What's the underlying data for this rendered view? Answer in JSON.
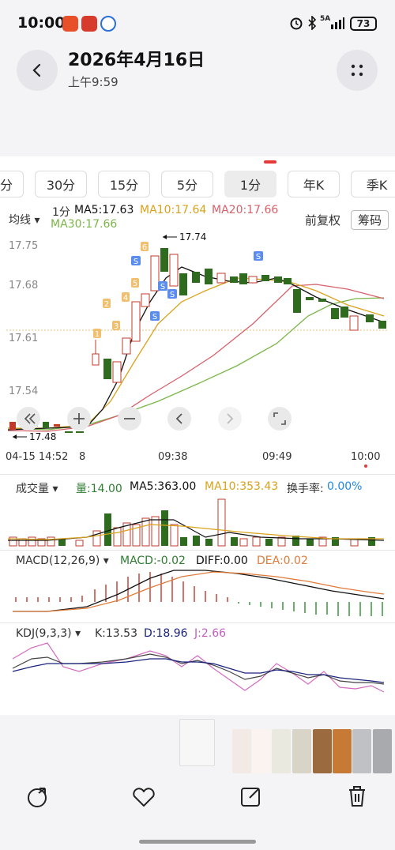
{
  "status": {
    "time": "10:00",
    "net": "5A",
    "battery": "73"
  },
  "header": {
    "title": "2026年4月16日",
    "subtitle": "上午9:59"
  },
  "chart": {
    "tabs": [
      "分",
      "30分",
      "15分",
      "5分",
      "1分",
      "年K",
      "季K"
    ],
    "active_tab": "1分",
    "avg_label": "均线",
    "period_label": "1分",
    "ma5": "MA5:17.63",
    "ma10": "MA10:17.64",
    "ma20": "MA20:17.66",
    "ma30": "MA30:17.66",
    "fuquan": "前复权",
    "chouma": "筹码",
    "y_ticks": [
      "17.75",
      "17.68",
      "17.61",
      "17.54"
    ],
    "high_label": "17.74",
    "low_label": "17.48",
    "x_ticks": [
      "04-15 14:52",
      "8",
      "09:38",
      "09:49",
      "10:00"
    ],
    "vol_label": "成交量",
    "vol_liang": "量:14.00",
    "vol_ma5": "MA5:363.00",
    "vol_ma10": "MA10:353.43",
    "vol_huanshou": "换手率:",
    "vol_huanshou_val": "0.00%",
    "macd_label": "MACD(12,26,9)",
    "macd_val": "MACD:-0.02",
    "diff_val": "DIFF:0.00",
    "dea_val": "DEA:0.02",
    "kdj_label": "KDJ(9,3,3)",
    "k_val": "K:13.53",
    "d_val": "D:18.96",
    "j_val": "J:2.66",
    "markers_num": [
      "1",
      "2",
      "3",
      "4",
      "5",
      "6"
    ],
    "marker_s": "S",
    "colors": {
      "up": "#c0392b",
      "down": "#2e6b1f",
      "ma5": "#111111",
      "ma10": "#d9a21b",
      "ma20": "#d7606a",
      "ma30": "#7ab648",
      "accent": "#1e88e5"
    }
  },
  "chart_data": {
    "type": "candlestick",
    "x_ticks": [
      "04-15 14:52",
      "09:38",
      "09:49",
      "10:00"
    ],
    "ylim": [
      17.47,
      17.76
    ],
    "high": 17.74,
    "low": 17.48,
    "ma": {
      "MA5": 17.63,
      "MA10": 17.64,
      "MA20": 17.66,
      "MA30": 17.66
    }
  },
  "bottom_nav": {
    "items": [
      "share-icon",
      "favorite-icon",
      "edit-icon",
      "delete-icon"
    ]
  }
}
